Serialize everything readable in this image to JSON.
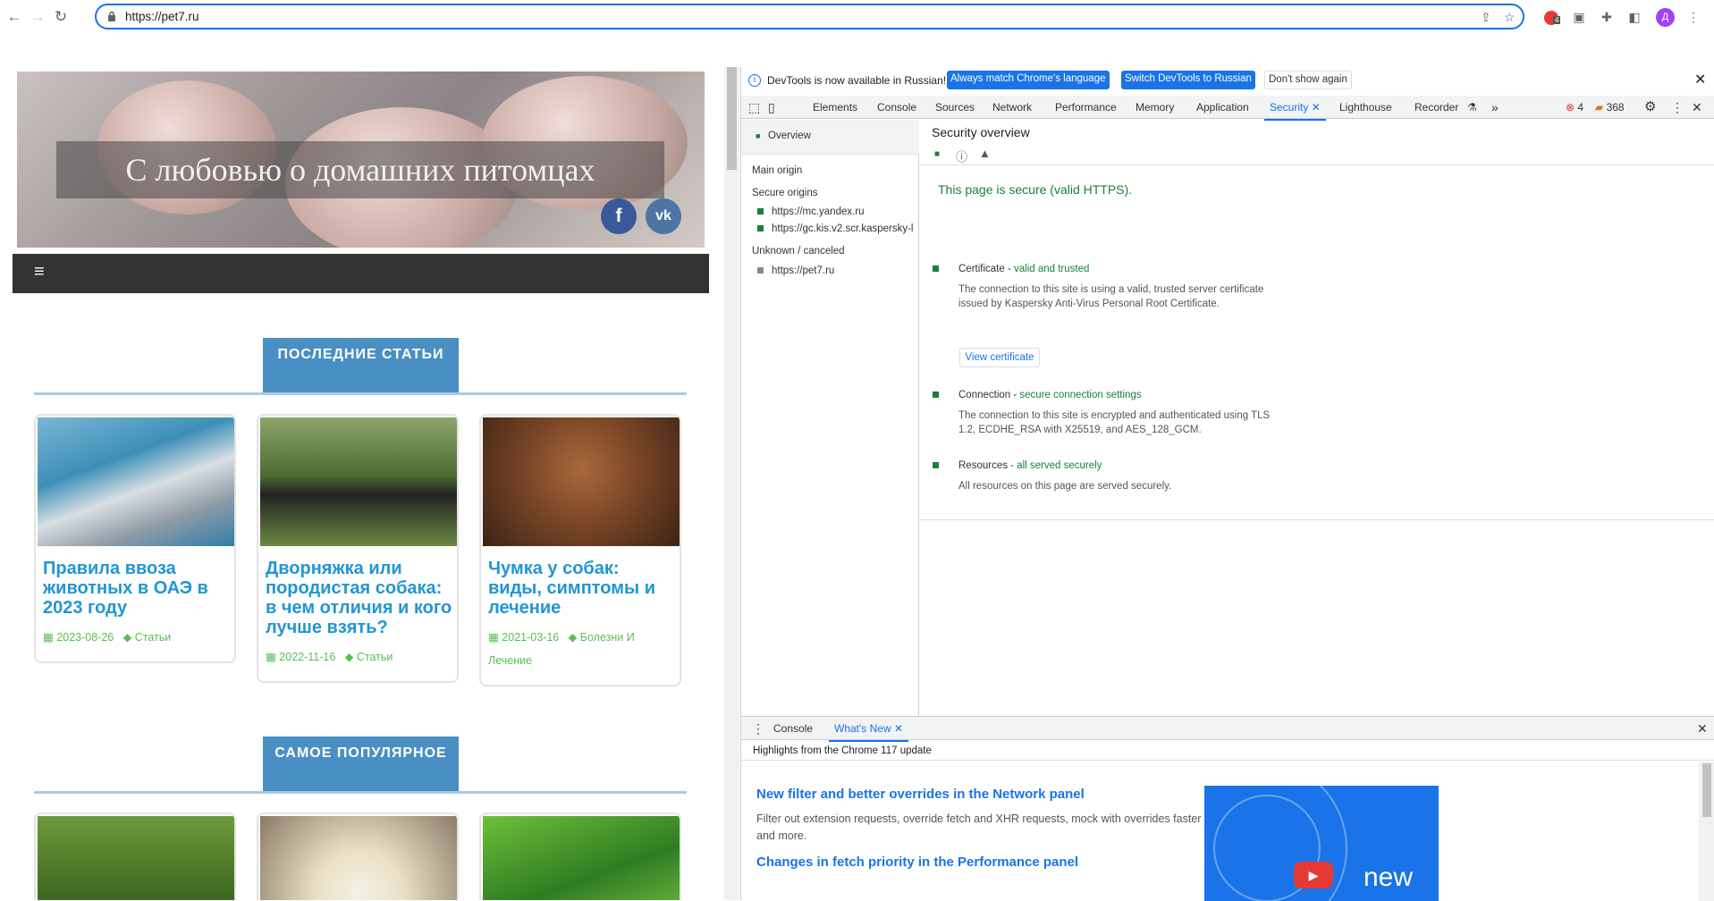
{
  "browser": {
    "url": "https://pet7.ru",
    "extension_badge": "4"
  },
  "profile": {
    "initial": "Д"
  },
  "site": {
    "hero_title": "С любовью о домашних питомцах",
    "social": {
      "facebook": "f",
      "vk": "vk"
    },
    "menu_icon": "≡",
    "sections": [
      {
        "title": "ПОСЛЕДНИЕ СТАТЬИ"
      },
      {
        "title": "САМОЕ ПОПУЛЯРНОЕ"
      }
    ],
    "cards": [
      {
        "title": "Правила ввоза животных в ОАЭ в 2023 году",
        "date": "2023-08-26",
        "category": "Статьи",
        "image": "dubai-marina-photo"
      },
      {
        "title": "Дворняжка или породистая собака: в чем отличия и кого лучше взять?",
        "date": "2022-11-16",
        "category": "Статьи",
        "image": "dog-paw-photo"
      },
      {
        "title": "Чумка у собак: виды, симптомы и лечение",
        "date": "2021-03-16",
        "category": "Болезни И Лечение",
        "image": "beagle-photo"
      }
    ],
    "popular_images": [
      "shepherd-puppy-photo",
      "cockatiel-photo",
      "aquarium-plant-photo"
    ]
  },
  "devtools": {
    "infobar": {
      "message": "DevTools is now available in Russian!",
      "btn_match": "Always match Chrome's language",
      "btn_switch": "Switch DevTools to Russian",
      "btn_dismiss": "Don't show again"
    },
    "tabs": [
      "Elements",
      "Console",
      "Sources",
      "Network",
      "Performance",
      "Memory",
      "Application",
      "Security",
      "Lighthouse",
      "Recorder"
    ],
    "active_tab": "Security",
    "errors": "4",
    "warnings": "368",
    "security": {
      "sidebar": {
        "overview": "Overview",
        "main_origin": "Main origin",
        "secure_origins": "Secure origins",
        "secure_list": [
          "https://mc.yandex.ru",
          "https://gc.kis.v2.scr.kaspersky-l"
        ],
        "unknown": "Unknown / canceled",
        "unknown_list": [
          "https://pet7.ru"
        ]
      },
      "title": "Security overview",
      "summary": "This page is secure (valid HTTPS).",
      "certificate": {
        "label": "Certificate - ",
        "status": "valid and trusted",
        "desc": "The connection to this site is using a valid, trusted server certificate issued by Kaspersky Anti-Virus Personal Root Certificate.",
        "button": "View certificate"
      },
      "connection": {
        "label": "Connection - ",
        "status": "secure connection settings",
        "desc": "The connection to this site is encrypted and authenticated using TLS 1.2, ECDHE_RSA with X25519, and AES_128_GCM."
      },
      "resources": {
        "label": "Resources - ",
        "status": "all served securely",
        "desc": "All resources on this page are served securely."
      }
    },
    "drawer": {
      "tabs": [
        "Console",
        "What's New"
      ],
      "active_tab": "What's New",
      "header": "Highlights from the Chrome 117 update",
      "items": [
        {
          "title": "New filter and better overrides in the Network panel",
          "desc": "Filter out extension requests, override fetch and XHR requests, mock with overrides faster with better UI, and more."
        },
        {
          "title": "Changes in fetch priority in the Performance panel"
        }
      ],
      "video_label": "new"
    }
  }
}
